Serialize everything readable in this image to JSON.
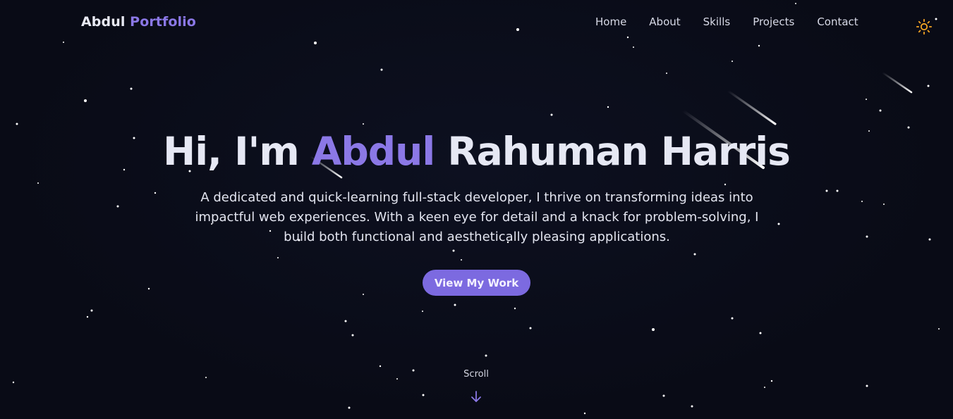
{
  "brand": {
    "first": "Abdul",
    "second": "Portfolio"
  },
  "nav": {
    "items": [
      "Home",
      "About",
      "Skills",
      "Projects",
      "Contact"
    ]
  },
  "theme_toggle": {
    "icon": "sun-icon",
    "color": "#f5a623"
  },
  "hero": {
    "title_prefix": "Hi, I'm ",
    "title_accent": "Abdul",
    "title_suffix": " Rahuman Harris",
    "description": "A dedicated and quick-learning full-stack developer, I thrive on transforming ideas into impactful web experiences. With a keen eye for detail and a knack for problem-solving, I build both functional and aesthetically pleasing applications.",
    "cta_label": "View My Work"
  },
  "scroll": {
    "label": "Scroll",
    "icon": "arrow-down-icon"
  },
  "colors": {
    "background": "#090b16",
    "accent": "#8b78e6",
    "button": "#7c6ae0",
    "text": "#e6e8f4"
  }
}
